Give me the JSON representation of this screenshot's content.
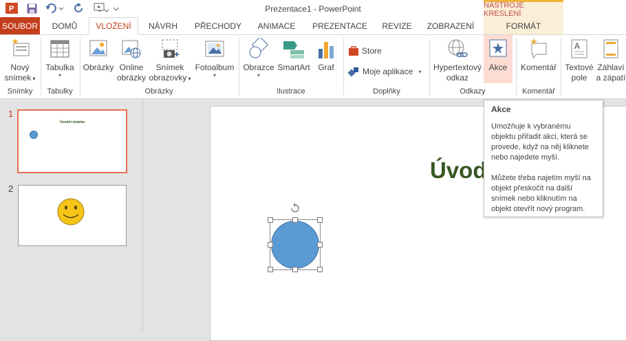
{
  "window": {
    "title": "Prezentace1 - PowerPoint"
  },
  "contextual": {
    "header": "NÁSTROJE KRESLENÍ"
  },
  "tabs": {
    "file": "SOUBOR",
    "home": "DOMŮ",
    "insert": "VLOŽENÍ",
    "design": "NÁVRH",
    "transitions": "PŘECHODY",
    "animations": "ANIMACE",
    "slideshow": "PREZENTACE",
    "review": "REVIZE",
    "view": "ZOBRAZENÍ",
    "format": "FORMÁT"
  },
  "ribbon": {
    "new_slide": [
      "Nový",
      "snímek"
    ],
    "table": "Tabulka",
    "pictures": "Obrázky",
    "online_pictures": [
      "Online",
      "obrázky"
    ],
    "screenshot": [
      "Snímek",
      "obrazovky"
    ],
    "photo_album": "Fotoalbum",
    "shapes": "Obrazce",
    "smartart": "SmartArt",
    "chart": "Graf",
    "store": "Store",
    "my_apps": "Moje aplikace",
    "hyperlink": [
      "Hypertextový",
      "odkaz"
    ],
    "action": "Akce",
    "comment": "Komentář",
    "textbox": [
      "Textové",
      "pole"
    ],
    "header_footer": [
      "Záhlaví",
      "a zápatí"
    ],
    "groups": {
      "slides": "Snímky",
      "tables": "Tabulky",
      "images": "Obrázky",
      "illustrations": "Ilustrace",
      "addins": "Doplňky",
      "links": "Odkazy",
      "comments": "Komentář"
    }
  },
  "thumbnails": [
    {
      "number": "1",
      "title": "Úvodní stránka"
    },
    {
      "number": "2"
    }
  ],
  "slide": {
    "title_partial": "Úvod"
  },
  "tooltip": {
    "title": "Akce",
    "paragraph1": "Umožňuje k vybranému objektu přiřadit akci, která se provede, když na něj kliknete nebo najedete myší.",
    "paragraph2": "Můžete třeba najetím myší na objekt přeskočit na další snímek nebo kliknutím na objekt otevřít nový program."
  },
  "colors": {
    "accent": "#c43e1c",
    "shape_fill": "#5b9bd5",
    "title_green": "#375623",
    "contextual_bg": "#fbeed6",
    "smiley": "#f5c518"
  }
}
